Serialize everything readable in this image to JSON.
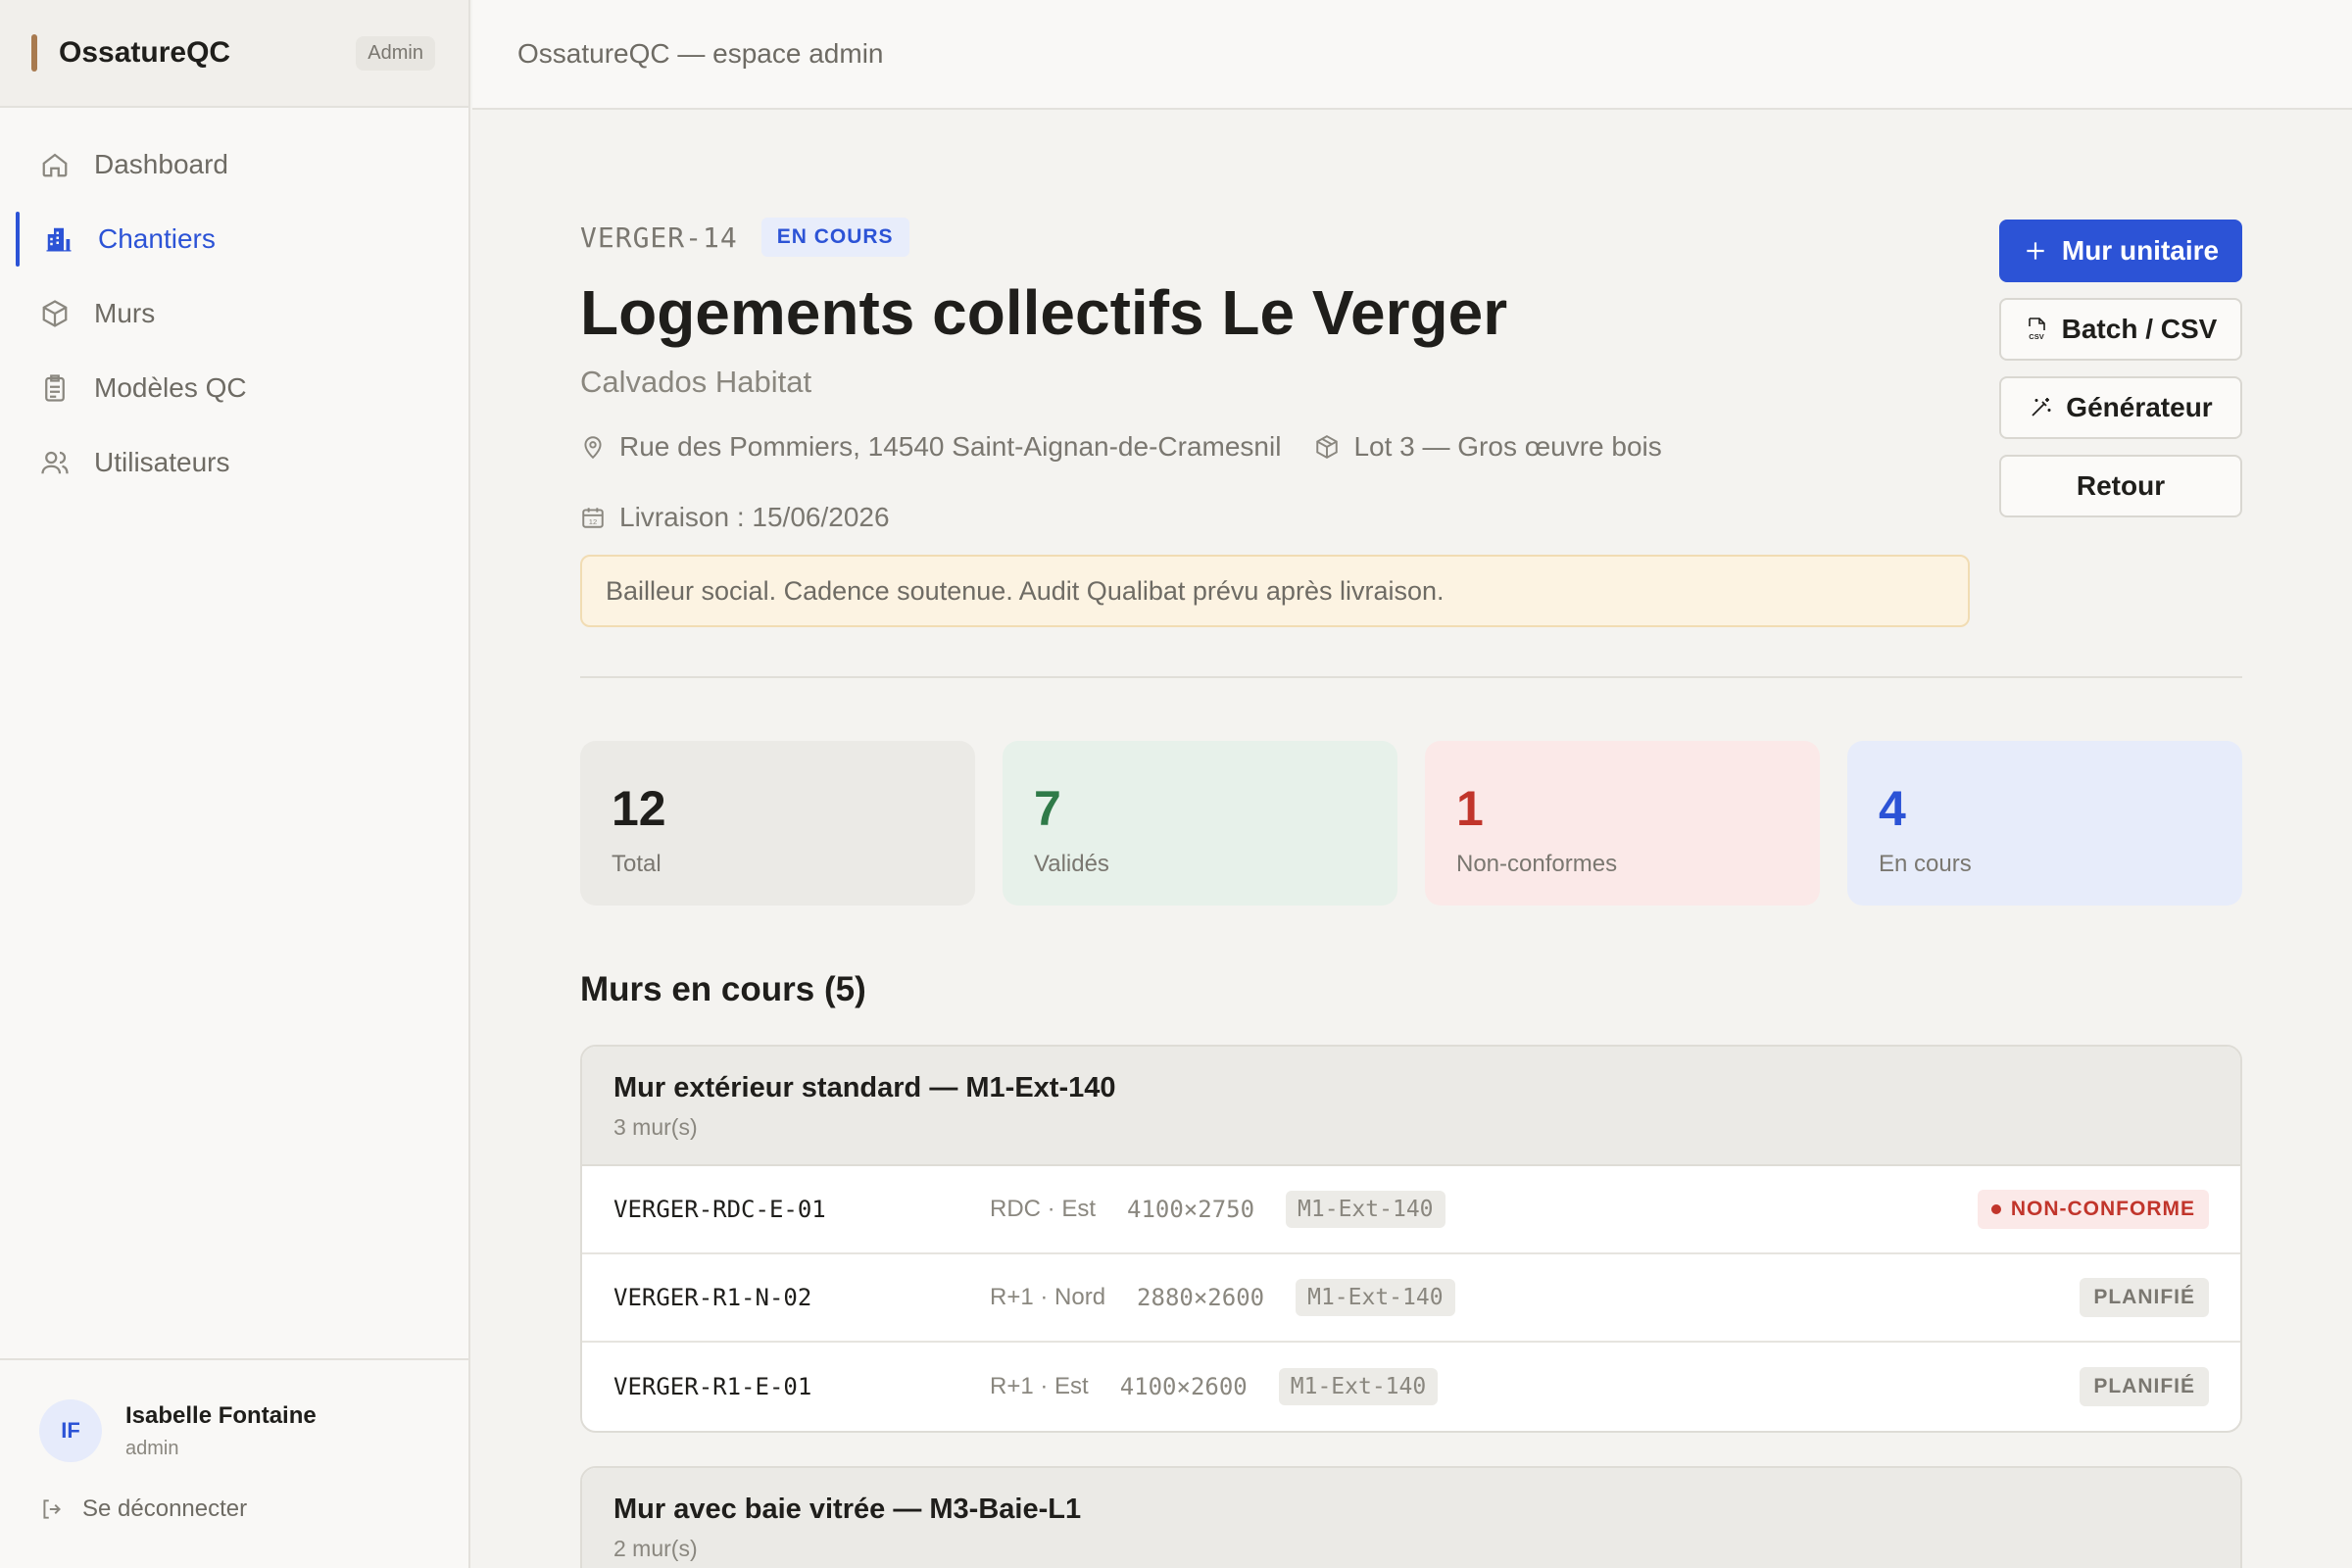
{
  "brand": {
    "name": "OssatureQC",
    "badge": "Admin"
  },
  "topbar": {
    "title": "OssatureQC — espace admin"
  },
  "nav": [
    {
      "label": "Dashboard",
      "icon": "home-icon",
      "active": false
    },
    {
      "label": "Chantiers",
      "icon": "building-icon",
      "active": true
    },
    {
      "label": "Murs",
      "icon": "cube-icon",
      "active": false
    },
    {
      "label": "Modèles QC",
      "icon": "clipboard-icon",
      "active": false
    },
    {
      "label": "Utilisateurs",
      "icon": "users-icon",
      "active": false
    }
  ],
  "user": {
    "initials": "IF",
    "name": "Isabelle Fontaine",
    "role": "admin",
    "logout": "Se déconnecter"
  },
  "project": {
    "code": "VERGER-14",
    "status": "EN COURS",
    "title": "Logements collectifs Le Verger",
    "client": "Calvados Habitat",
    "address": "Rue des Pommiers, 14540 Saint-Aignan-de-Cramesnil",
    "lot": "Lot 3 — Gros œuvre bois",
    "delivery": "Livraison : 15/06/2026",
    "note": "Bailleur social. Cadence soutenue. Audit Qualibat prévu après livraison."
  },
  "actions": {
    "mur_unitaire": "Mur unitaire",
    "batch": "Batch / CSV",
    "generateur": "Générateur",
    "retour": "Retour"
  },
  "stats": [
    {
      "value": "12",
      "label": "Total"
    },
    {
      "value": "7",
      "label": "Validés"
    },
    {
      "value": "1",
      "label": "Non-conformes"
    },
    {
      "value": "4",
      "label": "En cours"
    }
  ],
  "section": {
    "title": "Murs en cours (5)"
  },
  "groups": [
    {
      "title": "Mur extérieur standard — M1-Ext-140",
      "count": "3 mur(s)",
      "rows": [
        {
          "id": "VERGER-RDC-E-01",
          "loc": "RDC · Est",
          "dim": "4100×2750",
          "model": "M1-Ext-140",
          "status": "NON-CONFORME"
        },
        {
          "id": "VERGER-R1-N-02",
          "loc": "R+1 · Nord",
          "dim": "2880×2600",
          "model": "M1-Ext-140",
          "status": "PLANIFIÉ"
        },
        {
          "id": "VERGER-R1-E-01",
          "loc": "R+1 · Est",
          "dim": "4100×2600",
          "model": "M1-Ext-140",
          "status": "PLANIFIÉ"
        }
      ]
    },
    {
      "title": "Mur avec baie vitrée — M3-Baie-L1",
      "count": "2 mur(s)"
    }
  ]
}
